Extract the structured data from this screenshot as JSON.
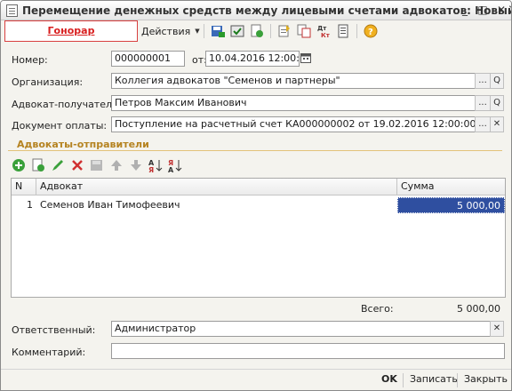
{
  "window": {
    "title": "Перемещение денежных средств между лицевыми счетами адвокатов: Новый",
    "min_label": "_",
    "max_label": "□",
    "close_label": "✕"
  },
  "tabs": {
    "active_label": "Гонорар"
  },
  "toolbar": {
    "actions_label": "Действия"
  },
  "form": {
    "number_label": "Номер:",
    "number_value": "000000001",
    "from_label": "от:",
    "date_value": "10.04.2016 12:00:00",
    "org_label": "Организация:",
    "org_value": "Коллегия адвокатов \"Семенов и партнеры\"",
    "recipient_label": "Адвокат-получатель:",
    "recipient_value": "Петров Максим Иванович",
    "payment_doc_label": "Документ оплаты:",
    "payment_doc_value": "Поступление на расчетный счет КА000000002 от 19.02.2016 12:00:00",
    "ellipsis": "...",
    "clear": "✕",
    "open": "Q"
  },
  "senders": {
    "section_title": "Адвокаты-отправители",
    "columns": {
      "n": "N",
      "lawyer": "Адвокат",
      "amount": "Сумма"
    },
    "rows": [
      {
        "n": "1",
        "lawyer": "Семенов Иван Тимофеевич",
        "amount": "5 000,00"
      }
    ],
    "total_label": "Всего:",
    "total_value": "5 000,00"
  },
  "footer": {
    "responsible_label": "Ответственный:",
    "responsible_value": "Администратор",
    "comment_label": "Комментарий:",
    "comment_value": ""
  },
  "bottom": {
    "ok_label": "OK",
    "save_label": "Записать",
    "close_label": "Закрыть"
  },
  "colors": {
    "accent_red": "#d81e1e",
    "section_gold": "#b58321",
    "selection": "#2f4fa0"
  }
}
